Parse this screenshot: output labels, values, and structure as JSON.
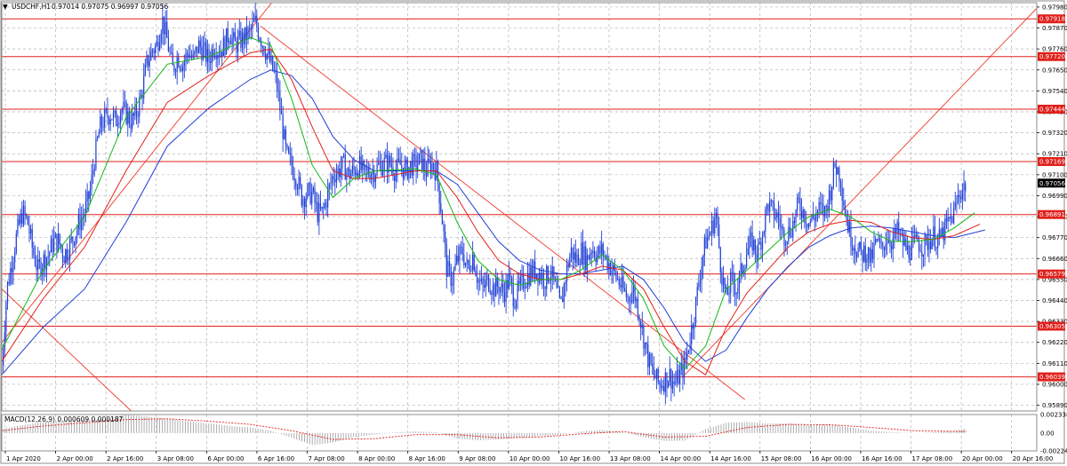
{
  "header": {
    "symbol": "USDCHF,H1",
    "ohlc": "0.97014 0.97075 0.96997 0.97056",
    "menu_glyph": "▼"
  },
  "macd_panel": {
    "label": "MACD(12,26,9) 0.000609 0.000187",
    "ticks": [
      "0.002338",
      "0.00",
      "-0.002247"
    ]
  },
  "colors": {
    "candle": "#1f3fd6",
    "frame": "#8c8c8c",
    "grid": "#b4b4b4",
    "hline": "#e0201b",
    "trend": "#ef3a2a",
    "ma_fast": "#14b814",
    "ma_mid": "#e0201b",
    "ma_slow": "#1f3fd6",
    "price_tag_bg": "#000000",
    "level_tag_bg": "#e0201b"
  },
  "chart_data": {
    "type": "candlestick",
    "symbol": "USDCHF",
    "timeframe": "H1",
    "ylim": [
      0.9586,
      0.98003
    ],
    "y_ticks": [
      "0.97980",
      "0.97870",
      "0.97760",
      "0.97650",
      "0.97540",
      "0.97430",
      "0.97320",
      "0.97210",
      "0.97100",
      "0.96990",
      "0.96880",
      "0.96770",
      "0.96660",
      "0.96550",
      "0.96440",
      "0.96330",
      "0.96220",
      "0.96110",
      "0.96000",
      "0.95890"
    ],
    "x_ticks": [
      "1 Apr 2020",
      "2 Apr 00:00",
      "2 Apr 16:00",
      "3 Apr 08:00",
      "6 Apr 00:00",
      "6 Apr 16:00",
      "7 Apr 08:00",
      "8 Apr 00:00",
      "8 Apr 16:00",
      "9 Apr 08:00",
      "10 Apr 00:00",
      "10 Apr 16:00",
      "13 Apr 08:00",
      "14 Apr 00:00",
      "14 Apr 16:00",
      "15 Apr 08:00",
      "16 Apr 00:00",
      "16 Apr 16:00",
      "17 Apr 08:00",
      "20 Apr 00:00",
      "20 Apr 16:00"
    ],
    "horizontal_levels": [
      "0.97918",
      "0.97720",
      "0.97444",
      "0.97169",
      "0.96891",
      "0.96579",
      "0.96305",
      "0.96039"
    ],
    "current_price": "0.97056",
    "price_path": [
      [
        0,
        0.961
      ],
      [
        5,
        0.965
      ],
      [
        10,
        0.9665
      ],
      [
        15,
        0.968
      ],
      [
        20,
        0.969
      ],
      [
        25,
        0.9685
      ],
      [
        30,
        0.967
      ],
      [
        35,
        0.966
      ],
      [
        40,
        0.9665
      ],
      [
        45,
        0.9668
      ],
      [
        50,
        0.9675
      ],
      [
        55,
        0.9675
      ],
      [
        60,
        0.9668
      ],
      [
        65,
        0.9672
      ],
      [
        70,
        0.9678
      ],
      [
        75,
        0.9685
      ],
      [
        80,
        0.969
      ],
      [
        85,
        0.97
      ],
      [
        90,
        0.972
      ],
      [
        95,
        0.9735
      ],
      [
        100,
        0.974
      ],
      [
        105,
        0.9742
      ],
      [
        110,
        0.9738
      ],
      [
        115,
        0.9745
      ],
      [
        120,
        0.9742
      ],
      [
        125,
        0.9738
      ],
      [
        130,
        0.9742
      ],
      [
        135,
        0.9752
      ],
      [
        140,
        0.9768
      ],
      [
        145,
        0.9775
      ],
      [
        150,
        0.9778
      ],
      [
        155,
        0.9792
      ],
      [
        160,
        0.978
      ],
      [
        165,
        0.9765
      ],
      [
        170,
        0.9772
      ],
      [
        175,
        0.9768
      ],
      [
        180,
        0.9775
      ],
      [
        185,
        0.977
      ],
      [
        190,
        0.9778
      ],
      [
        195,
        0.9775
      ],
      [
        200,
        0.977
      ],
      [
        205,
        0.9778
      ],
      [
        210,
        0.9775
      ],
      [
        215,
        0.9778
      ],
      [
        220,
        0.9785
      ],
      [
        225,
        0.9778
      ],
      [
        230,
        0.978
      ],
      [
        235,
        0.9782
      ],
      [
        240,
        0.9785
      ],
      [
        245,
        0.979
      ],
      [
        250,
        0.9782
      ],
      [
        255,
        0.9775
      ],
      [
        260,
        0.9768
      ],
      [
        265,
        0.976
      ],
      [
        270,
        0.974
      ],
      [
        275,
        0.972
      ],
      [
        280,
        0.9715
      ],
      [
        285,
        0.9708
      ],
      [
        290,
        0.9698
      ],
      [
        295,
        0.97
      ],
      [
        300,
        0.97
      ],
      [
        305,
        0.969
      ],
      [
        310,
        0.969
      ],
      [
        315,
        0.97
      ],
      [
        320,
        0.971
      ],
      [
        325,
        0.9712
      ],
      [
        330,
        0.9715
      ],
      [
        335,
        0.971
      ],
      [
        340,
        0.9712
      ],
      [
        345,
        0.9715
      ],
      [
        350,
        0.971
      ],
      [
        355,
        0.9712
      ],
      [
        360,
        0.9712
      ],
      [
        365,
        0.9715
      ],
      [
        370,
        0.9716
      ],
      [
        375,
        0.9716
      ],
      [
        380,
        0.9712
      ],
      [
        385,
        0.9715
      ],
      [
        390,
        0.9712
      ],
      [
        395,
        0.9715
      ],
      [
        400,
        0.9715
      ],
      [
        405,
        0.9718
      ],
      [
        410,
        0.9712
      ],
      [
        415,
        0.9716
      ],
      [
        420,
        0.9712
      ],
      [
        425,
        0.969
      ],
      [
        430,
        0.966
      ],
      [
        435,
        0.9655
      ],
      [
        440,
        0.9665
      ],
      [
        445,
        0.967
      ],
      [
        450,
        0.966
      ],
      [
        455,
        0.9668
      ],
      [
        460,
        0.9655
      ],
      [
        465,
        0.965
      ],
      [
        470,
        0.9655
      ],
      [
        475,
        0.965
      ],
      [
        480,
        0.9652
      ],
      [
        485,
        0.9648
      ],
      [
        490,
        0.9655
      ],
      [
        495,
        0.9645
      ],
      [
        500,
        0.965
      ],
      [
        505,
        0.9655
      ],
      [
        510,
        0.9658
      ],
      [
        515,
        0.966
      ],
      [
        520,
        0.9658
      ],
      [
        525,
        0.9655
      ],
      [
        530,
        0.966
      ],
      [
        535,
        0.965
      ],
      [
        540,
        0.964
      ],
      [
        545,
        0.9658
      ],
      [
        550,
        0.967
      ],
      [
        555,
        0.9665
      ],
      [
        560,
        0.967
      ],
      [
        565,
        0.9665
      ],
      [
        570,
        0.9672
      ],
      [
        575,
        0.9668
      ],
      [
        580,
        0.967
      ],
      [
        585,
        0.9665
      ],
      [
        590,
        0.966
      ],
      [
        595,
        0.9655
      ],
      [
        600,
        0.965
      ],
      [
        605,
        0.9645
      ],
      [
        610,
        0.965
      ],
      [
        615,
        0.964
      ],
      [
        620,
        0.9625
      ],
      [
        625,
        0.9612
      ],
      [
        630,
        0.9605
      ],
      [
        635,
        0.96
      ],
      [
        640,
        0.9602
      ],
      [
        645,
        0.9605
      ],
      [
        650,
        0.96
      ],
      [
        655,
        0.9605
      ],
      [
        660,
        0.961
      ],
      [
        665,
        0.9625
      ],
      [
        670,
        0.964
      ],
      [
        675,
        0.966
      ],
      [
        680,
        0.9675
      ],
      [
        685,
        0.968
      ],
      [
        690,
        0.969
      ],
      [
        695,
        0.966
      ],
      [
        700,
        0.9645
      ],
      [
        705,
        0.9655
      ],
      [
        710,
        0.965
      ],
      [
        715,
        0.966
      ],
      [
        720,
        0.967
      ],
      [
        725,
        0.9675
      ],
      [
        730,
        0.9668
      ],
      [
        735,
        0.968
      ],
      [
        740,
        0.9695
      ],
      [
        745,
        0.969
      ],
      [
        750,
        0.9688
      ],
      [
        755,
        0.9678
      ],
      [
        760,
        0.968
      ],
      [
        765,
        0.9685
      ],
      [
        770,
        0.9695
      ],
      [
        775,
        0.969
      ],
      [
        780,
        0.9685
      ],
      [
        785,
        0.9688
      ],
      [
        790,
        0.9692
      ],
      [
        795,
        0.969
      ],
      [
        800,
        0.97
      ],
      [
        805,
        0.9715
      ],
      [
        810,
        0.971
      ],
      [
        815,
        0.969
      ],
      [
        820,
        0.9678
      ],
      [
        825,
        0.9672
      ],
      [
        830,
        0.9668
      ],
      [
        835,
        0.967
      ],
      [
        840,
        0.9665
      ],
      [
        845,
        0.9675
      ],
      [
        850,
        0.967
      ],
      [
        855,
        0.9678
      ],
      [
        860,
        0.9675
      ],
      [
        865,
        0.968
      ],
      [
        870,
        0.9675
      ],
      [
        875,
        0.967
      ],
      [
        880,
        0.9672
      ],
      [
        885,
        0.9675
      ],
      [
        890,
        0.9672
      ],
      [
        895,
        0.9675
      ],
      [
        900,
        0.9678
      ],
      [
        905,
        0.9675
      ],
      [
        910,
        0.968
      ],
      [
        915,
        0.9685
      ],
      [
        920,
        0.969
      ],
      [
        925,
        0.97
      ],
      [
        930,
        0.9704
      ],
      [
        932,
        0.97056
      ]
    ],
    "ma_fast": [
      [
        0,
        0.9618
      ],
      [
        40,
        0.966
      ],
      [
        80,
        0.9688
      ],
      [
        120,
        0.974
      ],
      [
        160,
        0.9768
      ],
      [
        200,
        0.9772
      ],
      [
        240,
        0.9782
      ],
      [
        260,
        0.9778
      ],
      [
        280,
        0.975
      ],
      [
        300,
        0.9715
      ],
      [
        320,
        0.9698
      ],
      [
        340,
        0.9708
      ],
      [
        360,
        0.9712
      ],
      [
        400,
        0.9713
      ],
      [
        420,
        0.971
      ],
      [
        440,
        0.9685
      ],
      [
        460,
        0.9665
      ],
      [
        480,
        0.9655
      ],
      [
        500,
        0.9652
      ],
      [
        520,
        0.9655
      ],
      [
        540,
        0.9655
      ],
      [
        560,
        0.966
      ],
      [
        580,
        0.9668
      ],
      [
        600,
        0.966
      ],
      [
        620,
        0.9645
      ],
      [
        640,
        0.962
      ],
      [
        660,
        0.9608
      ],
      [
        680,
        0.962
      ],
      [
        700,
        0.965
      ],
      [
        720,
        0.966
      ],
      [
        740,
        0.967
      ],
      [
        760,
        0.968
      ],
      [
        780,
        0.9688
      ],
      [
        800,
        0.9692
      ],
      [
        820,
        0.9688
      ],
      [
        840,
        0.968
      ],
      [
        860,
        0.9675
      ],
      [
        880,
        0.9675
      ],
      [
        900,
        0.9676
      ],
      [
        920,
        0.9682
      ],
      [
        940,
        0.969
      ]
    ],
    "ma_mid": [
      [
        0,
        0.9612
      ],
      [
        40,
        0.9645
      ],
      [
        80,
        0.9672
      ],
      [
        120,
        0.9712
      ],
      [
        160,
        0.9748
      ],
      [
        200,
        0.9762
      ],
      [
        240,
        0.9774
      ],
      [
        260,
        0.9776
      ],
      [
        280,
        0.976
      ],
      [
        300,
        0.9735
      ],
      [
        320,
        0.9712
      ],
      [
        340,
        0.9708
      ],
      [
        360,
        0.9708
      ],
      [
        400,
        0.9712
      ],
      [
        420,
        0.9712
      ],
      [
        440,
        0.9698
      ],
      [
        460,
        0.968
      ],
      [
        480,
        0.9665
      ],
      [
        500,
        0.9658
      ],
      [
        520,
        0.9655
      ],
      [
        540,
        0.9655
      ],
      [
        560,
        0.9658
      ],
      [
        580,
        0.9662
      ],
      [
        600,
        0.966
      ],
      [
        620,
        0.965
      ],
      [
        640,
        0.963
      ],
      [
        660,
        0.9612
      ],
      [
        680,
        0.9605
      ],
      [
        700,
        0.963
      ],
      [
        720,
        0.9648
      ],
      [
        740,
        0.966
      ],
      [
        760,
        0.9672
      ],
      [
        780,
        0.968
      ],
      [
        800,
        0.9684
      ],
      [
        820,
        0.9686
      ],
      [
        840,
        0.9685
      ],
      [
        860,
        0.968
      ],
      [
        880,
        0.9677
      ],
      [
        900,
        0.9676
      ],
      [
        920,
        0.9678
      ],
      [
        945,
        0.9684
      ]
    ],
    "ma_slow": [
      [
        0,
        0.9605
      ],
      [
        40,
        0.963
      ],
      [
        80,
        0.965
      ],
      [
        120,
        0.9685
      ],
      [
        160,
        0.9725
      ],
      [
        200,
        0.9745
      ],
      [
        240,
        0.976
      ],
      [
        260,
        0.9765
      ],
      [
        280,
        0.9762
      ],
      [
        300,
        0.975
      ],
      [
        320,
        0.973
      ],
      [
        340,
        0.9718
      ],
      [
        360,
        0.9712
      ],
      [
        400,
        0.9712
      ],
      [
        420,
        0.9712
      ],
      [
        440,
        0.9705
      ],
      [
        460,
        0.969
      ],
      [
        480,
        0.9675
      ],
      [
        500,
        0.9665
      ],
      [
        520,
        0.966
      ],
      [
        540,
        0.9658
      ],
      [
        560,
        0.9658
      ],
      [
        580,
        0.966
      ],
      [
        600,
        0.9662
      ],
      [
        620,
        0.9655
      ],
      [
        640,
        0.964
      ],
      [
        660,
        0.9622
      ],
      [
        680,
        0.9612
      ],
      [
        700,
        0.9618
      ],
      [
        720,
        0.9635
      ],
      [
        740,
        0.965
      ],
      [
        760,
        0.9662
      ],
      [
        780,
        0.9672
      ],
      [
        800,
        0.9678
      ],
      [
        820,
        0.9682
      ],
      [
        840,
        0.9683
      ],
      [
        860,
        0.9682
      ],
      [
        880,
        0.968
      ],
      [
        900,
        0.9678
      ],
      [
        920,
        0.9677
      ],
      [
        950,
        0.9681
      ]
    ],
    "trend_lines": [
      [
        [
          0,
          0.9622
        ],
        [
          275,
          0.981
        ]
      ],
      [
        [
          250,
          0.9788
        ],
        [
          718,
          0.9592
        ]
      ],
      [
        [
          0,
          0.965
        ],
        [
          125,
          0.9586
        ]
      ],
      [
        [
          660,
          0.9605
        ],
        [
          1040,
          0.982
        ]
      ]
    ],
    "macd_hist": [
      [
        0,
        0.0005
      ],
      [
        20,
        0.001
      ],
      [
        40,
        0.0014
      ],
      [
        60,
        0.0015
      ],
      [
        80,
        0.0017
      ],
      [
        100,
        0.0018
      ],
      [
        120,
        0.0023
      ],
      [
        140,
        0.0021
      ],
      [
        160,
        0.0018
      ],
      [
        180,
        0.0015
      ],
      [
        200,
        0.0012
      ],
      [
        220,
        0.0009
      ],
      [
        240,
        0.0007
      ],
      [
        260,
        0.0003
      ],
      [
        280,
        -0.0006
      ],
      [
        300,
        -0.0015
      ],
      [
        320,
        -0.0012
      ],
      [
        340,
        -0.0005
      ],
      [
        360,
        -0.0002
      ],
      [
        380,
        0.0001
      ],
      [
        400,
        0.0002
      ],
      [
        420,
        0.0001
      ],
      [
        440,
        -0.0007
      ],
      [
        460,
        -0.0009
      ],
      [
        480,
        -0.0008
      ],
      [
        500,
        -0.0006
      ],
      [
        520,
        -0.0004
      ],
      [
        540,
        -0.0002
      ],
      [
        560,
        0.0002
      ],
      [
        580,
        0.0004
      ],
      [
        600,
        0.0001
      ],
      [
        620,
        -0.0005
      ],
      [
        640,
        -0.001
      ],
      [
        660,
        -0.00095
      ],
      [
        680,
        0.0005
      ],
      [
        700,
        0.0013
      ],
      [
        720,
        0.0014
      ],
      [
        740,
        0.0012
      ],
      [
        760,
        0.0012
      ],
      [
        780,
        0.001
      ],
      [
        800,
        0.0011
      ],
      [
        820,
        0.0007
      ],
      [
        840,
        0.0003
      ],
      [
        860,
        0.0001
      ],
      [
        880,
        0.0
      ],
      [
        900,
        0.0001
      ],
      [
        920,
        0.0003
      ],
      [
        932,
        0.0006
      ]
    ],
    "macd_signal": [
      [
        0,
        0.0003
      ],
      [
        40,
        0.0009
      ],
      [
        80,
        0.0013
      ],
      [
        120,
        0.0017
      ],
      [
        160,
        0.0018
      ],
      [
        200,
        0.0015
      ],
      [
        240,
        0.0011
      ],
      [
        280,
        0.0003
      ],
      [
        320,
        -0.0008
      ],
      [
        360,
        -0.0007
      ],
      [
        400,
        -0.0002
      ],
      [
        440,
        -0.0002
      ],
      [
        480,
        -0.0006
      ],
      [
        520,
        -0.0005
      ],
      [
        560,
        -0.0001
      ],
      [
        600,
        0.0002
      ],
      [
        640,
        -0.0005
      ],
      [
        680,
        -0.0004
      ],
      [
        720,
        0.0007
      ],
      [
        760,
        0.0011
      ],
      [
        800,
        0.00105
      ],
      [
        840,
        0.0007
      ],
      [
        880,
        0.0003
      ],
      [
        932,
        0.00019
      ]
    ]
  }
}
